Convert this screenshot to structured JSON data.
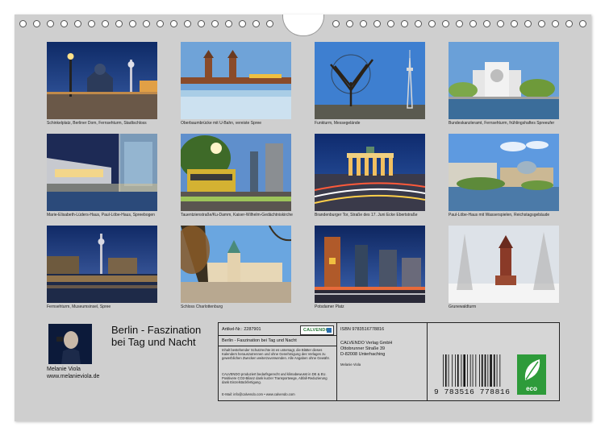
{
  "captions": [
    "Schinkelplatz, Berliner Dom, Fernsehturm, Stadtschloss",
    "Oberbaumbrücke mit U-Bahn, vereiste Spree",
    "Funkturm, Messegelände",
    "Bundeskanzleramt, Fernsehturm, frühlingshaftes Spreeufer",
    "Marie-Elisabeth-Lüders-Haus, Paul-Löbe-Haus, Spreebogen",
    "Tauentzienstraße/Ku-Damm, Kaiser-Wilhelm-Gedächtniskirche",
    "Brandenburger Tor, Straße des 17. Juni Ecke Ebertstraße",
    "Paul-Löbe-Haus mit Wasserspielen, Reichstagsgebäude",
    "Fernsehturm, Museumsinsel, Spree",
    "Schloss Charlottenburg",
    "Potsdamer Platz",
    "Grunewaldturm"
  ],
  "author": {
    "name": "Melanie Viola",
    "website": "www.melanieviola.de"
  },
  "title": "Berlin - Faszination bei Tag und Nacht",
  "info": {
    "article_no": "Artikel-Nr.: 2287901",
    "logo": "CALVENDO",
    "product_title": "Berlin - Faszination bei Tag und Nacht",
    "legal_text": "Inhalt bestehender Schutzrechte ist es untersagt, die Blätter dieses Kalenders herauszutrennen und ohne Genehmigung des Verlages zu gewerblichen Zwecken weiterzuverwenden. Alle Angaben ohne Gewähr.",
    "eco_text": "CALVENDO produziert bedarfsgerecht und klimabewusst in DE & EU. Positivere CO2-Bilanz dank kurzer Transportwege, Abfall-Reduzierung dank Einzelstückfertigung.",
    "contact": "E-Mail: info@calvendo.com • www.calvendo.com",
    "isbn": "ISBN 9783516778816",
    "publisher": [
      "CALVENDO Verlag GmbH",
      "Ottobrunner Straße 39",
      "D-82008 Unterhaching"
    ],
    "author_small": "Melanie Viola",
    "barcode_number": "9  783516  778816",
    "eco_label": "eco"
  }
}
